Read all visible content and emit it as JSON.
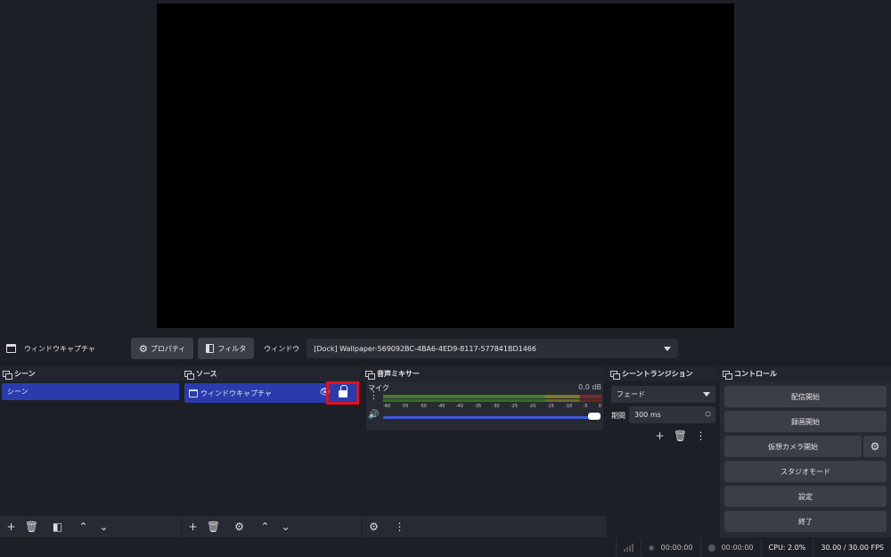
{
  "source_toolbar": {
    "title": "ウィンドウキャプチャ",
    "properties_label": "プロパティ",
    "filters_label": "フィルタ",
    "window_label": "ウィンドウ",
    "window_value": "[Dock] Wallpaper-569092BC-4BA6-4ED9-8117-577841BD1466"
  },
  "scenes": {
    "title": "シーン",
    "items": [
      "シーン"
    ]
  },
  "sources": {
    "title": "ソース",
    "items": [
      "ウィンドウキャプチャ"
    ]
  },
  "mixer": {
    "title": "音声ミキサー",
    "channel_name": "マイク",
    "channel_db": "0.0 dB",
    "ticks": [
      "-60",
      "-55",
      "-50",
      "-45",
      "-40",
      "-35",
      "-30",
      "-25",
      "-20",
      "-15",
      "-10",
      "-5",
      "0"
    ]
  },
  "transitions": {
    "title": "シーントランジション",
    "selected": "フェード",
    "duration_label": "期間",
    "duration_value": "300 ms"
  },
  "controls": {
    "title": "コントロール",
    "buttons": [
      "配信開始",
      "録画開始",
      "仮想カメラ開始",
      "スタジオモード",
      "設定",
      "終了"
    ]
  },
  "status": {
    "stream_time": "00:00:00",
    "rec_time": "00:00:00",
    "cpu": "CPU: 2.0%",
    "fps": "30.00 / 30.00 FPS"
  }
}
